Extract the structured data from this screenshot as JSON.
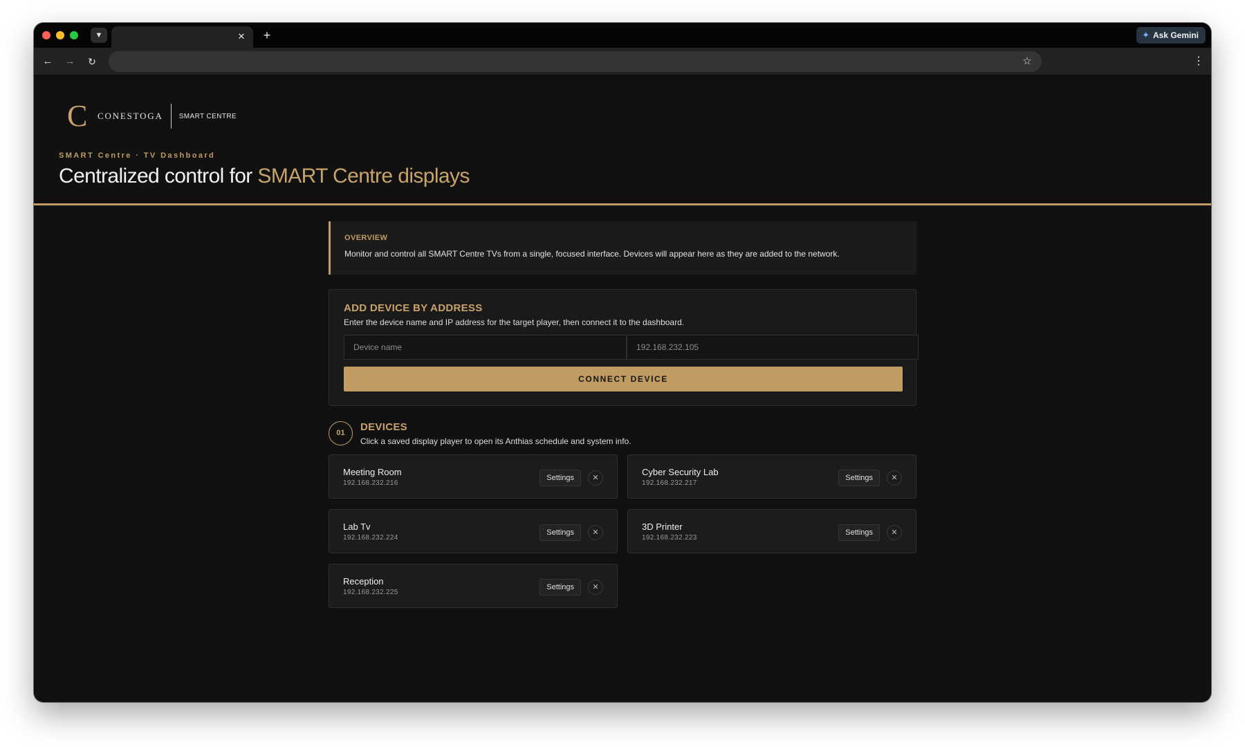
{
  "browser": {
    "tab_title": "",
    "ask_gemini_label": "Ask Gemini",
    "address_value": "",
    "icons": [
      "tab-search-icon",
      "close-icon",
      "plus-icon",
      "back-arrow-icon",
      "forward-arrow-icon",
      "reload-icon",
      "star-icon",
      "kebab-menu-icon",
      "gemini-spark-icon"
    ]
  },
  "brand": {
    "logo_mark": "C",
    "name": "CONESTOGA",
    "subtitle": "SMART CENTRE"
  },
  "header": {
    "eyebrow": "SMART Centre · TV Dashboard",
    "headline_prefix": "Centralized control for ",
    "headline_accent": "SMART Centre displays"
  },
  "overview": {
    "label": "OVERVIEW",
    "text": "Monitor and control all SMART Centre TVs from a single, focused interface. Devices will appear here as they are added to the network."
  },
  "add_device": {
    "title": "ADD DEVICE BY ADDRESS",
    "description": "Enter the device name and IP address for the target player, then connect it to the dashboard.",
    "name_placeholder": "Device name",
    "ip_placeholder": "192.168.232.105",
    "connect_label": "CONNECT DEVICE"
  },
  "devices": {
    "badge": "01",
    "title": "DEVICES",
    "description": "Click a saved display player to open its Anthias schedule and system info.",
    "settings_label": "Settings",
    "remove_glyph": "✕",
    "items": [
      {
        "name": "Meeting Room",
        "ip": "192.168.232.216"
      },
      {
        "name": "Cyber Security Lab",
        "ip": "192.168.232.217"
      },
      {
        "name": "Lab Tv",
        "ip": "192.168.232.224"
      },
      {
        "name": "3D Printer",
        "ip": "192.168.232.223"
      },
      {
        "name": "Reception",
        "ip": "192.168.232.225"
      }
    ]
  },
  "colors": {
    "accent": "#c19c62",
    "background": "#111111",
    "card": "#1c1c1c"
  }
}
